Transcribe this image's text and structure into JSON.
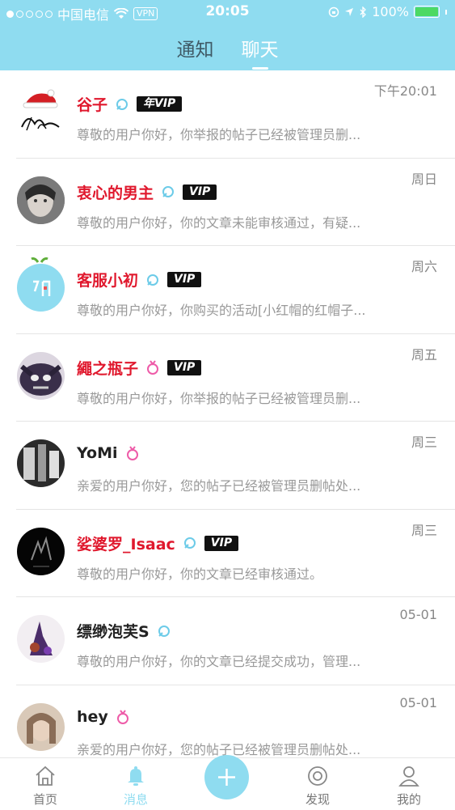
{
  "status": {
    "carrier": "中国电信",
    "vpn": "VPN",
    "time": "20:05",
    "battery": "100%",
    "battery_level": 1.0
  },
  "tabs": [
    {
      "label": "通知"
    },
    {
      "label": "聊天"
    }
  ],
  "messages": [
    {
      "name": "谷子",
      "badge": "年VIP",
      "time": "下午20:01",
      "preview": "尊敬的用户你好，你举报的帖子已经被管理员删..."
    },
    {
      "name": "衷心的男主",
      "badge": "VIP",
      "time": "周日",
      "preview": "尊敬的用户你好，你的文章未能审核通过，有疑..."
    },
    {
      "name": "客服小初",
      "badge": "VIP",
      "time": "周六",
      "preview": "尊敬的用户你好，你购买的活动[小红帽的红帽子..."
    },
    {
      "name": "繩之瓶子",
      "badge": "VIP",
      "time": "周五",
      "preview": "尊敬的用户你好，你举报的帖子已经被管理员删..."
    },
    {
      "name": "YoMi",
      "badge": "",
      "time": "周三",
      "preview": "亲爱的用户你好，您的帖子已经被管理员删帖处..."
    },
    {
      "name": "娑婆罗_Isaac",
      "badge": "VIP",
      "time": "周三",
      "preview": "尊敬的用户你好，你的文章已经审核通过。"
    },
    {
      "name": "缥缈泡芙S",
      "badge": "",
      "time": "05-01",
      "preview": "尊敬的用户你好，你的文章已经提交成功，管理..."
    },
    {
      "name": "hey",
      "badge": "",
      "time": "05-01",
      "preview": "亲爱的用户你好，您的帖子已经被管理员删帖处..."
    }
  ],
  "nav": [
    {
      "label": "首页"
    },
    {
      "label": "消息"
    },
    {
      "label": "发现"
    },
    {
      "label": "我的"
    }
  ],
  "colors": {
    "accent": "#8fdcf0",
    "vip_name": "#e0182d"
  }
}
